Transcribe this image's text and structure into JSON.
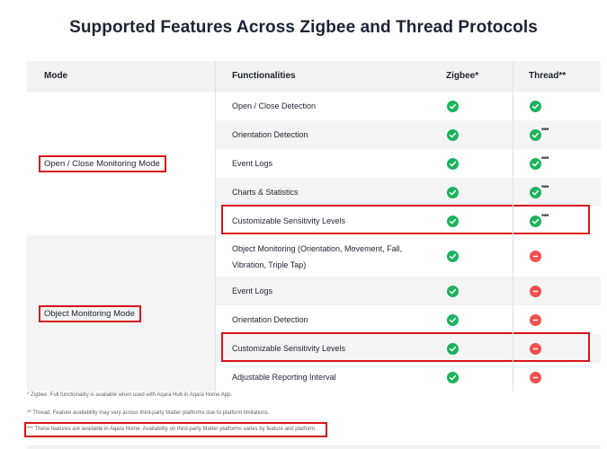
{
  "title": "Supported Features Across Zigbee and Thread Protocols",
  "header": {
    "mode": "Mode",
    "functionalities": "Functionalities",
    "zigbee": "Zigbee*",
    "thread": "Thread**"
  },
  "modes": [
    {
      "label": "Open / Close Monitoring Mode",
      "features": [
        {
          "name": "Open / Close Detection",
          "zigbee": "check",
          "thread": "check",
          "thread_note": ""
        },
        {
          "name": "Orientation Detection",
          "zigbee": "check",
          "thread": "check",
          "thread_note": "***"
        },
        {
          "name": "Event Logs",
          "zigbee": "check",
          "thread": "check",
          "thread_note": "***"
        },
        {
          "name": "Charts & Statistics",
          "zigbee": "check",
          "thread": "check",
          "thread_note": "***"
        },
        {
          "name": "Customizable Sensitivity Levels",
          "zigbee": "check",
          "thread": "check",
          "thread_note": "***"
        }
      ]
    },
    {
      "label": "Object Monitoring Mode",
      "features": [
        {
          "name": "Object Monitoring (Orientation, Movement, Fall, Vibration, Triple Tap)",
          "zigbee": "check",
          "thread": "unsupported",
          "thread_note": ""
        },
        {
          "name": "Event Logs",
          "zigbee": "check",
          "thread": "unsupported",
          "thread_note": ""
        },
        {
          "name": "Orientation Detection",
          "zigbee": "check",
          "thread": "unsupported",
          "thread_note": ""
        },
        {
          "name": "Customizable Sensitivity Levels",
          "zigbee": "check",
          "thread": "unsupported",
          "thread_note": ""
        },
        {
          "name": "Adjustable Reporting Interval",
          "zigbee": "check",
          "thread": "unsupported",
          "thread_note": ""
        }
      ]
    }
  ],
  "footnotes": [
    "* Zigbee: Full functionality is available when used with Aqara Hub in Aqara Home App.",
    "** Thread: Feature availability may vary across third-party Matter platforms due to platform limitations.",
    "*** These features are available in Aqara Home. Availability on third-party Matter platforms varies by feature and platform."
  ],
  "colors": {
    "check": "#1cb35e",
    "unsupported": "#f0514f",
    "highlight": "#d9141b",
    "title": "#1c2434"
  },
  "icons": {
    "check": "check-circle-icon",
    "unsupported": "minus-circle-icon"
  }
}
